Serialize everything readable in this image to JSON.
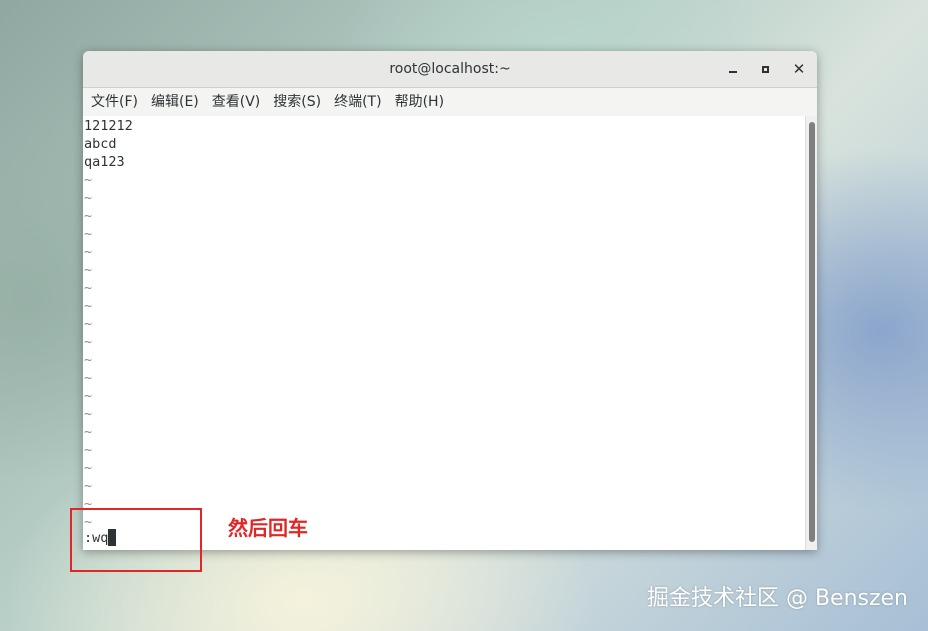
{
  "window": {
    "title": "root@localhost:~",
    "controls": {
      "minimize": "minimize",
      "maximize": "maximize",
      "close": "close"
    }
  },
  "menu": {
    "items": [
      "文件(F)",
      "编辑(E)",
      "查看(V)",
      "搜索(S)",
      "终端(T)",
      "帮助(H)"
    ]
  },
  "terminal": {
    "lines": [
      "121212",
      "abcd",
      "qa123"
    ],
    "tilde": "~",
    "tilde_count": 20,
    "command": ":wq"
  },
  "annotation": {
    "text": "然后回车",
    "color": "#e02626"
  },
  "watermark": {
    "text": "掘金技术社区 @ Benszen"
  }
}
